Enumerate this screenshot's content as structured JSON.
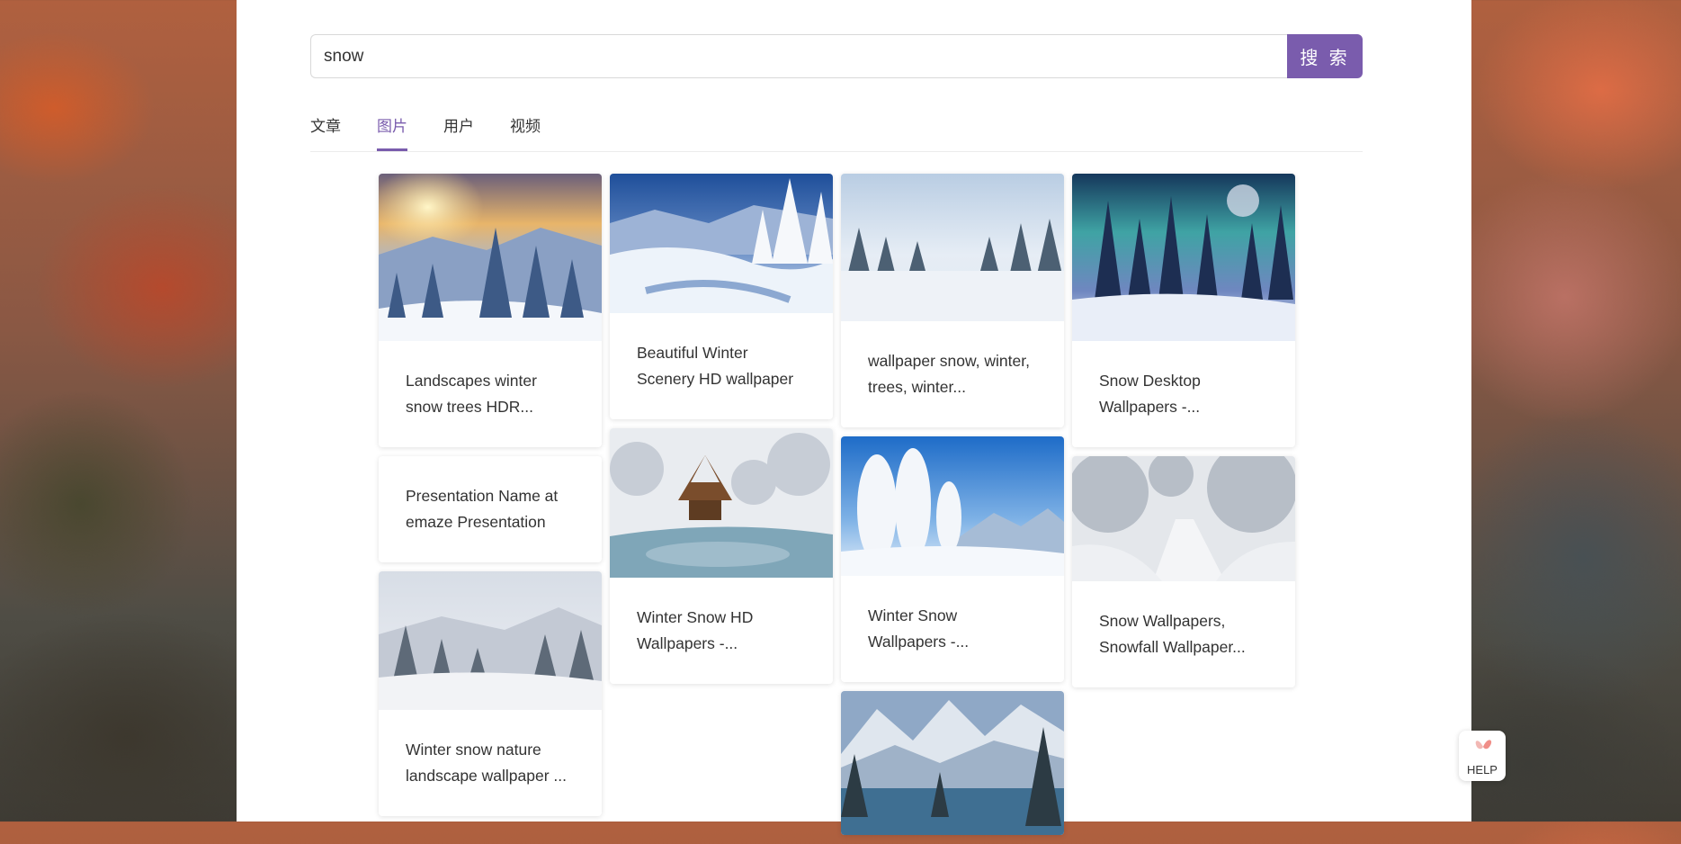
{
  "search": {
    "value": "snow",
    "button_label": "搜 索"
  },
  "tabs": [
    {
      "label": "文章",
      "active": false
    },
    {
      "label": "图片",
      "active": true
    },
    {
      "label": "用户",
      "active": false
    },
    {
      "label": "视频",
      "active": false
    }
  ],
  "cards": [
    {
      "title": "Landscapes winter snow trees HDR..."
    },
    {
      "title": "Presentation Name at emaze Presentation"
    },
    {
      "title": "Winter snow nature landscape wallpaper ..."
    },
    {
      "title": "Beautiful Winter Scenery HD wallpaper"
    },
    {
      "title": "Winter Snow HD Wallpapers -..."
    },
    {
      "title": "wallpaper snow, winter, trees, winter..."
    },
    {
      "title": "Winter Snow Wallpapers -..."
    },
    {
      "title": "Snow Desktop Wallpapers -..."
    },
    {
      "title": "Snow Wallpapers, Snowfall Wallpaper..."
    }
  ],
  "help": {
    "label": "HELP"
  },
  "colors": {
    "accent": "#7a5cad"
  }
}
